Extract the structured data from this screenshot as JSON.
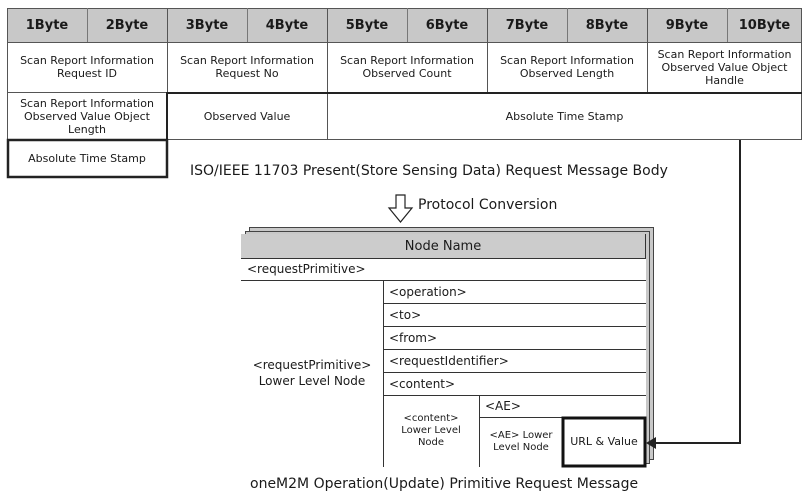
{
  "header_row": [
    "1Byte",
    "2Byte",
    "3Byte",
    "4Byte",
    "5Byte",
    "6Byte",
    "7Byte",
    "8Byte",
    "9Byte",
    "10Byte"
  ],
  "fields": {
    "request_id": "Scan Report Information Request ID",
    "request_no": "Scan Report Information Request No",
    "observed_count": "Scan Report Information Observed Count",
    "observed_length": "Scan Report Information Observed Length",
    "object_handle": "Scan Report Information Observed Value Object Handle",
    "object_length": "Scan Report Information Observed Value Object Length",
    "observed_value": "Observed Value",
    "absolute_time_stamp_1": "Absolute Time Stamp",
    "absolute_time_stamp_2": "Absolute Time Stamp"
  },
  "caption_top": "ISO/IEEE 11703 Present(Store Sensing Data) Request Message Body",
  "conversion_label": "Protocol Conversion",
  "node_table": {
    "header": "Node Name",
    "request_primitive": "<requestPrimitive>",
    "lower_level": "<requestPrimitive> Lower Level Node",
    "items": [
      "<operation>",
      "<to>",
      "<from>",
      "<requestIdentifier>",
      "<content>"
    ],
    "content_lower": "<content> Lower Level Node",
    "ae": "<AE>",
    "ae_lower": "<AE> Lower Level Node",
    "url_value": "URL & Value"
  },
  "caption_bottom": "oneM2M Operation(Update) Primitive Request Message"
}
